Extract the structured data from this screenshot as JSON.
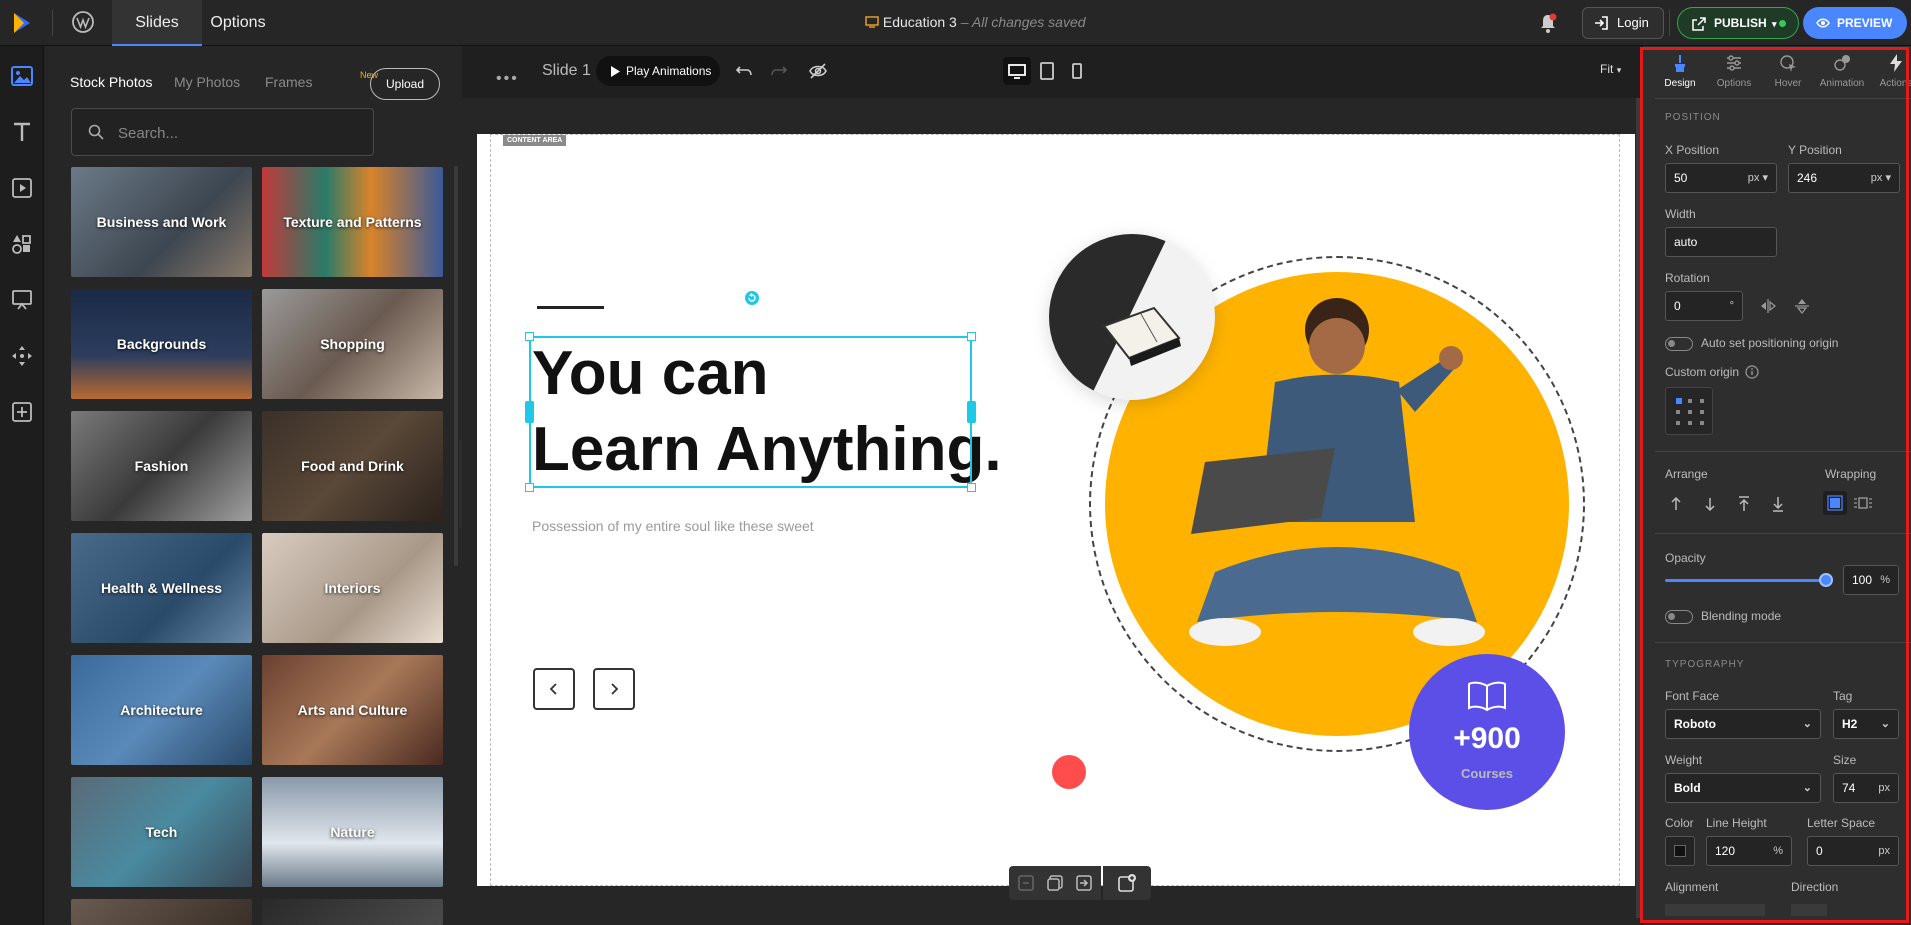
{
  "topbar": {
    "tabs": [
      "Slides",
      "Options"
    ],
    "doc_title": "Education 3",
    "doc_status": "– All changes saved",
    "login_label": "Login",
    "publish_label": "PUBLISH",
    "preview_label": "PREVIEW"
  },
  "rail": {
    "icons": [
      "image-icon",
      "text-icon",
      "video-icon",
      "elements-icon",
      "presentation-icon",
      "move-icon",
      "add-block-icon"
    ]
  },
  "photos": {
    "tabs": [
      "Stock Photos",
      "My Photos",
      "Frames"
    ],
    "new_badge": "New",
    "upload_label": "Upload",
    "search_placeholder": "Search...",
    "categories": [
      "Business and Work",
      "Texture and Patterns",
      "Backgrounds",
      "Shopping",
      "Fashion",
      "Food and Drink",
      "Health & Wellness",
      "Interiors",
      "Architecture",
      "Arts and Culture",
      "Tech",
      "Nature"
    ]
  },
  "canvas_toolbar": {
    "slide_label": "Slide 1",
    "play_label": "Play Animations",
    "fit_label": "Fit"
  },
  "slide": {
    "content_area_label": "CONTENT AREA",
    "heading_line1": "You can",
    "heading_line2": "Learn Anything.",
    "subtext": "Possession of my entire soul like these sweet",
    "badge_number": "+900",
    "badge_label": "Courses"
  },
  "design_panel": {
    "tabs": [
      "Design",
      "Options",
      "Hover",
      "Animation",
      "Actions"
    ],
    "position_section": "POSITION",
    "x_label": "X Position",
    "x_value": "50",
    "x_unit": "px",
    "y_label": "Y Position",
    "y_value": "246",
    "y_unit": "px",
    "width_label": "Width",
    "width_value": "auto",
    "rotation_label": "Rotation",
    "rotation_value": "0",
    "rotation_unit": "°",
    "auto_origin_label": "Auto set positioning origin",
    "custom_origin_label": "Custom origin",
    "arrange_label": "Arrange",
    "wrapping_label": "Wrapping",
    "opacity_label": "Opacity",
    "opacity_value": "100",
    "opacity_unit": "%",
    "blending_label": "Blending mode",
    "typography_section": "TYPOGRAPHY",
    "font_face_label": "Font Face",
    "font_face_value": "Roboto",
    "tag_label": "Tag",
    "tag_value": "H2",
    "weight_label": "Weight",
    "weight_value": "Bold",
    "size_label": "Size",
    "size_value": "74",
    "size_unit": "px",
    "color_label": "Color",
    "line_height_label": "Line Height",
    "line_height_value": "120",
    "line_height_unit": "%",
    "letter_space_label": "Letter Space",
    "letter_space_value": "0",
    "letter_space_unit": "px",
    "alignment_label": "Alignment",
    "direction_label": "Direction"
  },
  "colors": {
    "accent": "#4a86ff",
    "selection": "#1ec8e7",
    "publish_green": "#2ecc59",
    "highlight_frame": "#e41a1a",
    "badge_purple": "#5b4fe8",
    "circle_yellow": "#ffb300"
  }
}
